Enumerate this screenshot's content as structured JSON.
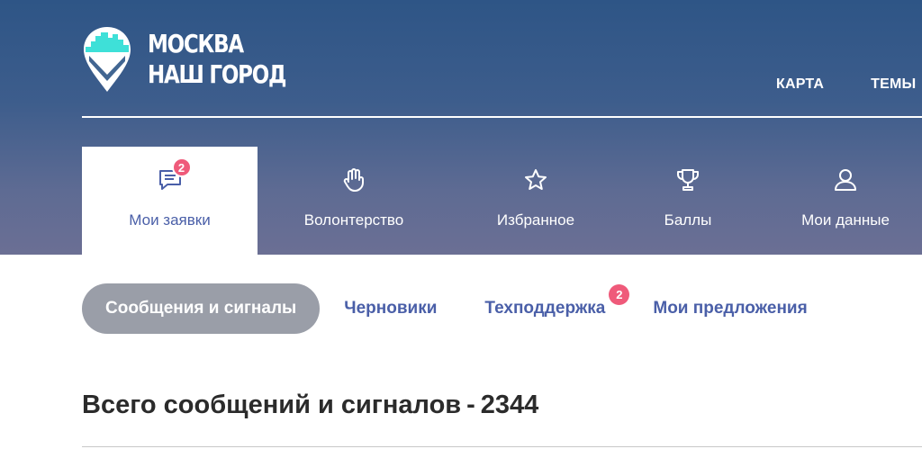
{
  "logo": {
    "line1": "МОСКВА",
    "line2": "НАШ ГОРОД",
    "icon": "location-pin-city-icon",
    "accent": "#3ee0d8"
  },
  "topnav": [
    {
      "label": "КАРТА"
    },
    {
      "label": "ТЕМЫ"
    }
  ],
  "tabs": [
    {
      "label": "Мои заявки",
      "icon": "chat-icon",
      "badge": "2",
      "active": true
    },
    {
      "label": "Волонтерство",
      "icon": "hand-icon"
    },
    {
      "label": "Избранное",
      "icon": "star-icon"
    },
    {
      "label": "Баллы",
      "icon": "trophy-icon"
    },
    {
      "label": "Мои данные",
      "icon": "user-icon"
    }
  ],
  "subtabs": [
    {
      "label": "Сообщения и сигналы",
      "active": true
    },
    {
      "label": "Черновики"
    },
    {
      "label": "Техподдержка",
      "badge": "2"
    },
    {
      "label": "Мои предложения"
    }
  ],
  "summary": {
    "text": "Всего сообщений и сигналов",
    "separator": "-",
    "count": "2344"
  },
  "colors": {
    "accent": "#4a5fa8",
    "badge": "#ef5a7a",
    "active_pill": "#9a9ea8",
    "header_top": "#2e5586",
    "header_bottom": "#6b6f94"
  }
}
